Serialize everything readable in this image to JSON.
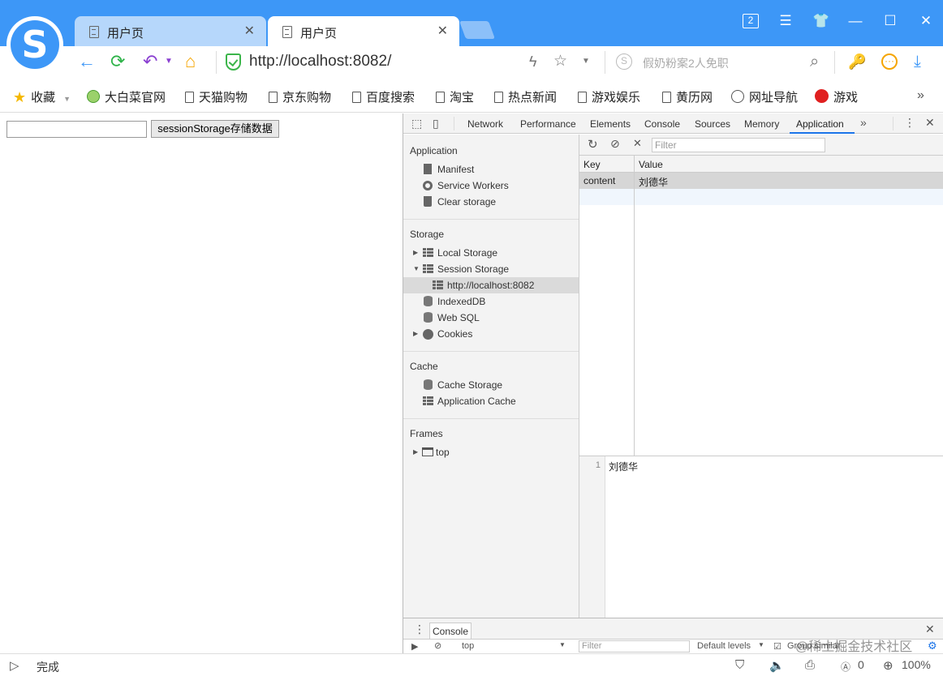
{
  "browser": {
    "tabs": [
      {
        "title": "用户页",
        "close": "✕"
      },
      {
        "title": "用户页",
        "close": "✕"
      }
    ],
    "tab_count": "2",
    "url": "http://localhost:8082/",
    "search_placeholder": "假奶粉案2人免职",
    "accent_color": "#3d97f7"
  },
  "bookmarks": [
    {
      "label": "收藏",
      "icon": "star-icon"
    },
    {
      "label": "大白菜官网",
      "icon": "cabbage-icon"
    },
    {
      "label": "天猫购物",
      "icon": "page-icon"
    },
    {
      "label": "京东购物",
      "icon": "page-icon"
    },
    {
      "label": "百度搜索",
      "icon": "page-icon"
    },
    {
      "label": "淘宝",
      "icon": "page-icon"
    },
    {
      "label": "热点新闻",
      "icon": "page-icon"
    },
    {
      "label": "游戏娱乐",
      "icon": "page-icon"
    },
    {
      "label": "黄历网",
      "icon": "page-icon"
    },
    {
      "label": "网址导航",
      "icon": "globe-icon"
    },
    {
      "label": "游戏",
      "icon": "game-icon"
    }
  ],
  "page": {
    "input_value": "",
    "button_label": "sessionStorage存储数据"
  },
  "devtools": {
    "tabs": [
      "Network",
      "Performance",
      "Elements",
      "Console",
      "Sources",
      "Memory",
      "Application"
    ],
    "active_tab": "Application",
    "sidebar": {
      "application": {
        "heading": "Application",
        "items": [
          "Manifest",
          "Service Workers",
          "Clear storage"
        ]
      },
      "storage": {
        "heading": "Storage",
        "items": [
          "Local Storage",
          "Session Storage",
          "http://localhost:8082",
          "IndexedDB",
          "Web SQL",
          "Cookies"
        ]
      },
      "cache": {
        "heading": "Cache",
        "items": [
          "Cache Storage",
          "Application Cache"
        ]
      },
      "frames": {
        "heading": "Frames",
        "items": [
          "top"
        ]
      }
    },
    "filter_placeholder": "Filter",
    "table": {
      "headers": [
        "Key",
        "Value"
      ],
      "rows": [
        {
          "key": "content",
          "value": "刘德华"
        }
      ]
    },
    "preview": {
      "line_number": "1",
      "text": "刘德华"
    },
    "drawer": {
      "tab": "Console",
      "context": "top",
      "filter_placeholder": "Filter",
      "levels": "Default levels",
      "group_similar": "Group similar"
    }
  },
  "status": {
    "text": "完成",
    "count": "0",
    "zoom": "100%"
  },
  "watermark": "@稀土掘金技术社区"
}
